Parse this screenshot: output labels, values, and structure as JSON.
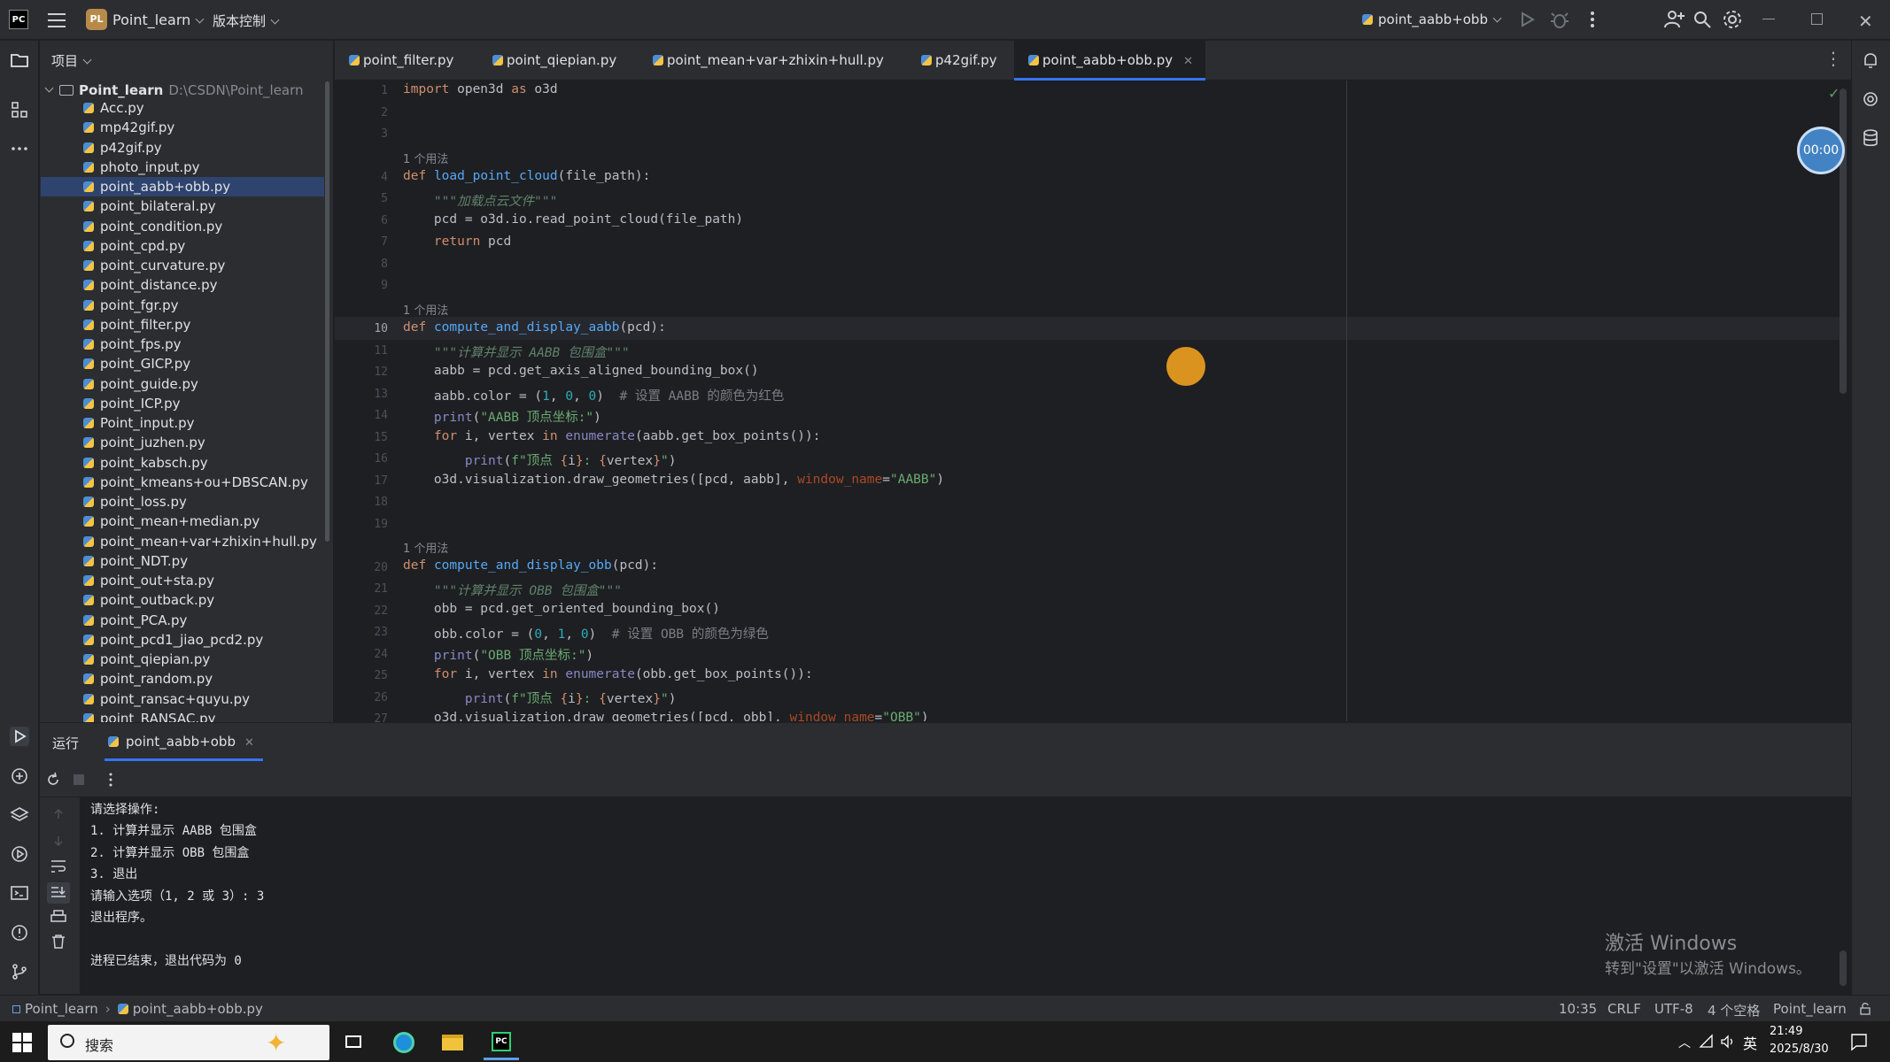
{
  "titlebar": {
    "ide_badge": "PC",
    "project_badge": "PL",
    "project_name": "Point_learn",
    "vcs_label": "版本控制",
    "run_config": "point_aabb+obb"
  },
  "sidebar": {
    "header": "项目",
    "root_name": "Point_learn",
    "root_path": "D:\\CSDN\\Point_learn",
    "files": [
      "Acc.py",
      "mp42gif.py",
      "p42gif.py",
      "photo_input.py",
      "point_aabb+obb.py",
      "point_bilateral.py",
      "point_condition.py",
      "point_cpd.py",
      "point_curvature.py",
      "point_distance.py",
      "point_fgr.py",
      "point_filter.py",
      "point_fps.py",
      "point_GICP.py",
      "point_guide.py",
      "point_ICP.py",
      "Point_input.py",
      "point_juzhen.py",
      "point_kabsch.py",
      "point_kmeans+ou+DBSCAN.py",
      "point_loss.py",
      "point_mean+median.py",
      "point_mean+var+zhixin+hull.py",
      "point_NDT.py",
      "point_out+sta.py",
      "point_outback.py",
      "point_PCA.py",
      "point_pcd1_jiao_pcd2.py",
      "point_qiepian.py",
      "point_random.py",
      "point_ransac+quyu.py",
      "point_RANSAC.py"
    ],
    "selected_index": 4
  },
  "tabs": [
    {
      "label": "point_filter.py",
      "active": false
    },
    {
      "label": "point_qiepian.py",
      "active": false
    },
    {
      "label": "point_mean+var+zhixin+hull.py",
      "active": false
    },
    {
      "label": "p42gif.py",
      "active": false
    },
    {
      "label": "point_aabb+obb.py",
      "active": true
    }
  ],
  "editor": {
    "usage_hint": "1 个用法",
    "line_numbers": [
      "1",
      "2",
      "3",
      "4",
      "5",
      "6",
      "7",
      "8",
      "9",
      "10",
      "11",
      "12",
      "13",
      "14",
      "15",
      "16",
      "17",
      "18",
      "19",
      "20",
      "21",
      "22",
      "23",
      "24",
      "25",
      "26",
      "27"
    ],
    "current_line": "10",
    "timer": "00:00"
  },
  "run_panel": {
    "title": "运行",
    "tab_label": "point_aabb+obb",
    "output": [
      "请选择操作:",
      "1. 计算并显示 AABB 包围盒",
      "2. 计算并显示 OBB 包围盒",
      "3. 退出",
      "请输入选项（1, 2 或 3）: 3",
      "退出程序。",
      "",
      "进程已结束，退出代码为 0"
    ],
    "watermark_title": "激活 Windows",
    "watermark_sub": "转到\"设置\"以激活 Windows。"
  },
  "statusbar": {
    "crumb_project": "Point_learn",
    "crumb_file": "point_aabb+obb.py",
    "position": "10:35",
    "line_sep": "CRLF",
    "encoding": "UTF-8",
    "indent": "4 个空格",
    "interpreter": "Point_learn"
  },
  "taskbar": {
    "search_placeholder": "搜索",
    "lang": "英",
    "time": "21:49",
    "date": "2025/8/30"
  },
  "colors": {
    "accent": "#3574f0",
    "selection": "#2e436e",
    "timer": "#4383c4",
    "cursor_marker": "#f0a020"
  }
}
